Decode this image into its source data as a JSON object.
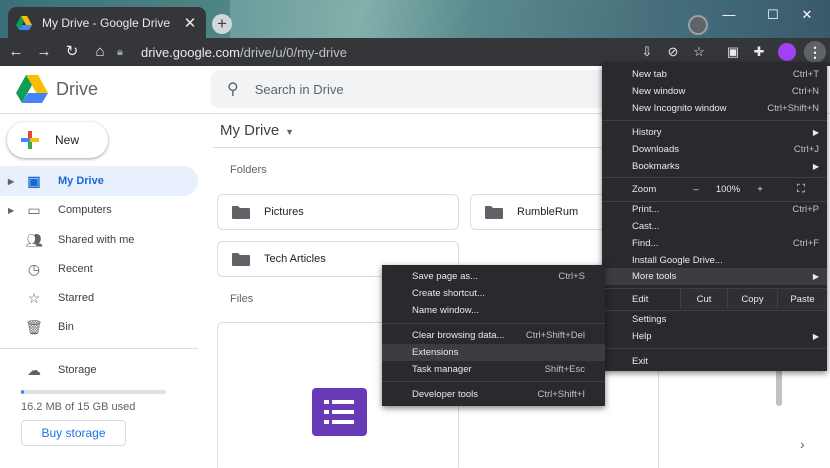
{
  "browser": {
    "tab_title": "My Drive - Google Drive",
    "tab_close": "✕",
    "new_tab": "+",
    "url_host": "drive.google.com",
    "url_path": "/drive/u/0/my-drive",
    "window_controls": {
      "minimize": "—",
      "maximize": "☐",
      "close": "✕"
    }
  },
  "drive": {
    "logo_text": "Drive",
    "search_placeholder": "Search in Drive",
    "new_button": "New",
    "sidebar": [
      {
        "label": "My Drive",
        "icon": "my-drive-icon",
        "caret": true,
        "active": true
      },
      {
        "label": "Computers",
        "icon": "computers-icon",
        "caret": true,
        "active": false
      },
      {
        "label": "Shared with me",
        "icon": "shared-icon",
        "caret": false,
        "active": false
      },
      {
        "label": "Recent",
        "icon": "clock-icon",
        "caret": false,
        "active": false
      },
      {
        "label": "Starred",
        "icon": "star-icon",
        "caret": false,
        "active": false
      },
      {
        "label": "Bin",
        "icon": "bin-icon",
        "caret": false,
        "active": false
      }
    ],
    "storage_label": "Storage",
    "storage_text": "16.2 MB of 15 GB used",
    "storage_used_fraction": 0.0011,
    "buy_storage": "Buy storage",
    "main_title": "My Drive",
    "folders_label": "Folders",
    "files_label": "Files",
    "folders": [
      "Pictures",
      "RumbleRum",
      "Tech Articles"
    ]
  },
  "menu": {
    "new_tab": "New tab",
    "new_tab_sc": "Ctrl+T",
    "new_window": "New window",
    "new_window_sc": "Ctrl+N",
    "incognito": "New Incognito window",
    "incognito_sc": "Ctrl+Shift+N",
    "history": "History",
    "downloads": "Downloads",
    "downloads_sc": "Ctrl+J",
    "bookmarks": "Bookmarks",
    "zoom": "Zoom",
    "zoom_minus": "–",
    "zoom_value": "100%",
    "zoom_plus": "+",
    "print": "Print...",
    "print_sc": "Ctrl+P",
    "cast": "Cast...",
    "find": "Find...",
    "find_sc": "Ctrl+F",
    "install": "Install Google Drive...",
    "more_tools": "More tools",
    "edit": "Edit",
    "cut": "Cut",
    "copy": "Copy",
    "paste": "Paste",
    "settings": "Settings",
    "help": "Help",
    "exit": "Exit"
  },
  "submenu": {
    "save_page": "Save page as...",
    "save_page_sc": "Ctrl+S",
    "create_shortcut": "Create shortcut...",
    "name_window": "Name window...",
    "clear_data": "Clear browsing data...",
    "clear_data_sc": "Ctrl+Shift+Del",
    "extensions": "Extensions",
    "task_manager": "Task manager",
    "task_manager_sc": "Shift+Esc",
    "dev_tools": "Developer tools",
    "dev_tools_sc": "Ctrl+Shift+I"
  },
  "colors": {
    "accent": "#1a73e8",
    "menu_bg": "#292a2d",
    "chrome_bar": "#35363a"
  }
}
